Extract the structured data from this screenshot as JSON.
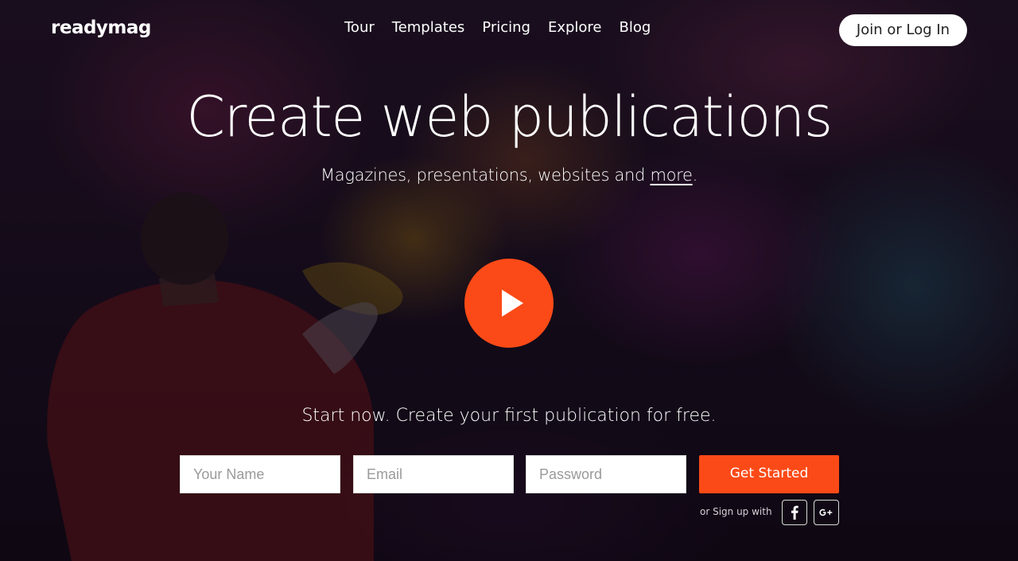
{
  "brand": {
    "logo": "readymag"
  },
  "nav": {
    "items": [
      {
        "label": "Tour"
      },
      {
        "label": "Templates"
      },
      {
        "label": "Pricing"
      },
      {
        "label": "Explore"
      },
      {
        "label": "Blog"
      }
    ],
    "join_label": "Join or Log In"
  },
  "hero": {
    "title": "Create web publications",
    "subtitle_prefix": "Magazines, presentations, websites and ",
    "subtitle_link": "more",
    "subtitle_suffix": "."
  },
  "video": {
    "play_icon": "play-icon",
    "accent": "#fb4a17"
  },
  "signup": {
    "cta_text": "Start now. Create your first publication for free.",
    "name_placeholder": "Your Name",
    "email_placeholder": "Email",
    "password_placeholder": "Password",
    "submit_label": "Get Started",
    "social_text": "or Sign up with",
    "social_icons": [
      "facebook-icon",
      "google-plus-icon"
    ]
  },
  "colors": {
    "accent": "#fb4a17",
    "button_light": "#ffffff"
  }
}
